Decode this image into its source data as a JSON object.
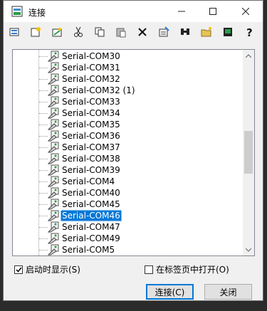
{
  "window": {
    "title": "连接",
    "icon": "connect-app-icon"
  },
  "titlebar_buttons": [
    "minimize-icon",
    "maximize-icon",
    "close-icon"
  ],
  "toolbar": {
    "icons": [
      "connect-icon",
      "new-session-icon",
      "quick-connect-icon",
      "cut-icon",
      "copy-icon",
      "paste-icon",
      "delete-icon",
      "properties-icon",
      "find-icon",
      "new-folder-icon",
      "desktop-icon",
      "help-icon"
    ]
  },
  "sessions": {
    "items": [
      "Serial-COM30",
      "Serial-COM31",
      "Serial-COM32",
      "Serial-COM32 (1)",
      "Serial-COM33",
      "Serial-COM34",
      "Serial-COM35",
      "Serial-COM36",
      "Serial-COM37",
      "Serial-COM38",
      "Serial-COM39",
      "Serial-COM4",
      "Serial-COM40",
      "Serial-COM45",
      "Serial-COM46",
      "Serial-COM47",
      "Serial-COM49",
      "Serial-COM5"
    ],
    "selected": "Serial-COM46",
    "selection_color": "#0078d7"
  },
  "options": {
    "show_on_startup": {
      "label": "启动时显示(S)",
      "checked": true
    },
    "open_in_tab": {
      "label": "在标签页中打开(O)",
      "checked": false
    }
  },
  "buttons": {
    "connect": "连接(C)",
    "close": "关闭"
  }
}
